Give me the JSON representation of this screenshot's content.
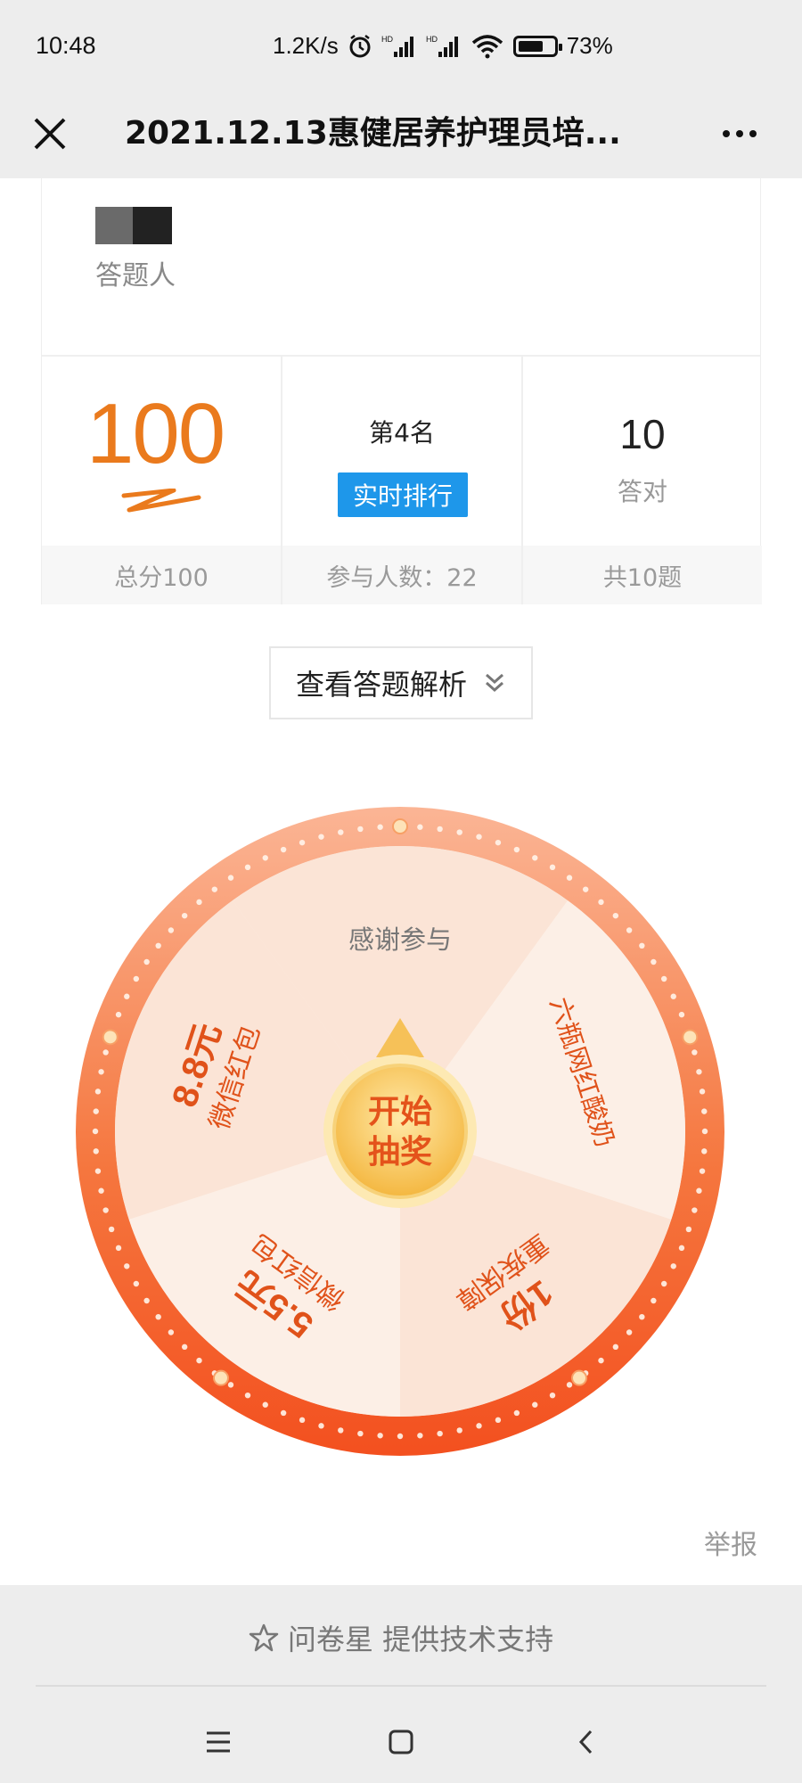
{
  "status_bar": {
    "time": "10:48",
    "net_speed": "1.2K/s",
    "battery": "73%",
    "battery_level": 0.73
  },
  "title_bar": {
    "title": "2021.12.13惠健居养护理员培...",
    "close_icon": "close-icon",
    "more_icon": "more-icon"
  },
  "respondent": {
    "label": "答题人"
  },
  "stats": {
    "score": "100",
    "total_score": "总分100",
    "rank": "第4名",
    "rank_button": "实时排行",
    "participants": "参与人数：22",
    "correct_count": "10",
    "correct_label": "答对",
    "total_questions": "共10题"
  },
  "analysis_button": {
    "label": "查看答题解析",
    "icon": "double-chevron-down-icon"
  },
  "lottery": {
    "start_button": [
      "开始",
      "抽奖"
    ],
    "prizes": [
      {
        "amount": "",
        "label": "感谢参与"
      },
      {
        "amount": "",
        "label": "六瓶网红酸奶"
      },
      {
        "amount": "1份",
        "label": "重疾保障"
      },
      {
        "amount": "5.5元",
        "label": "微信红包"
      },
      {
        "amount": "8.8元",
        "label": "微信红包"
      }
    ],
    "colors": {
      "rim_top": "#fbb595",
      "rim_bottom": "#f3501f",
      "segment_light": "#fcefe6",
      "segment_dark": "#fbe4d6",
      "accent_text": "#e0521a",
      "button": "#f6c158"
    }
  },
  "report_link": "举报",
  "footer": {
    "powered_by": "问卷星 提供技术支持",
    "star_icon": "star-outline-icon"
  },
  "nav_bar": {
    "icons": [
      "menu-icon",
      "home-square-icon",
      "back-icon"
    ]
  },
  "colors": {
    "score_orange": "#ea7a1d",
    "rank_button_blue": "#1e97ea",
    "chrome_gray": "#ededed"
  }
}
